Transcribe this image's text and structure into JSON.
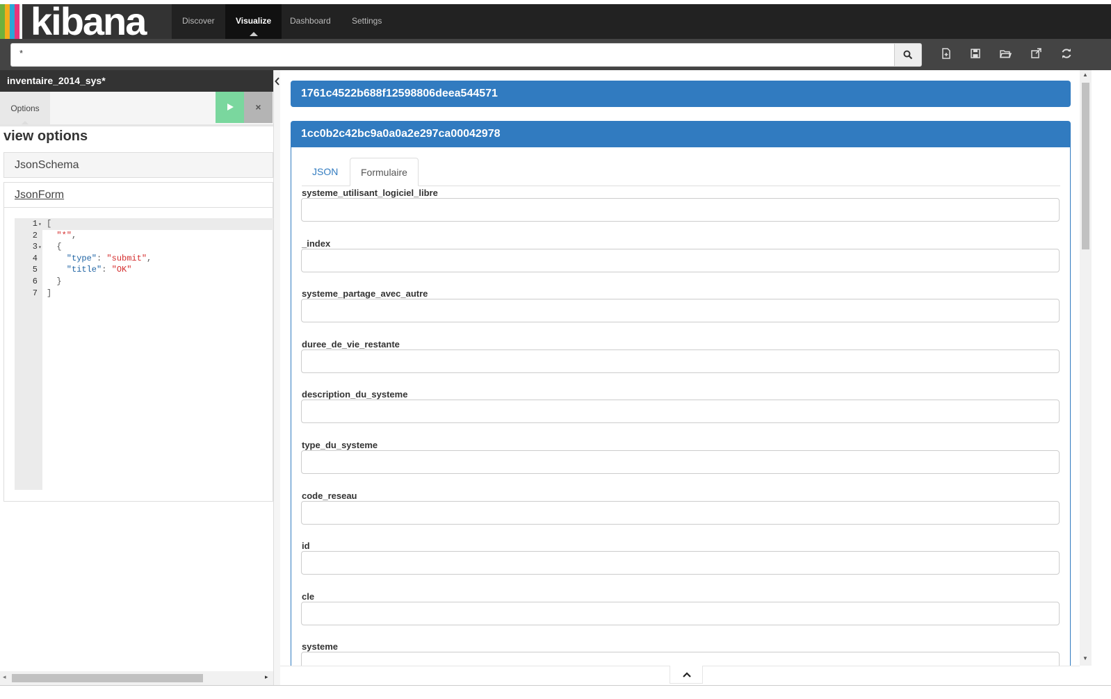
{
  "app": {
    "logo_text": "kibana"
  },
  "nav": {
    "items": [
      "Discover",
      "Visualize",
      "Dashboard",
      "Settings"
    ],
    "active": "Visualize"
  },
  "search": {
    "query": "*"
  },
  "toolbar": {
    "icons": [
      "new-document-icon",
      "save-icon",
      "open-folder-icon",
      "share-icon",
      "refresh-icon"
    ]
  },
  "sidebar": {
    "title": "inventaire_2014_sys*",
    "tab_label": "Options",
    "apply_icon": "play-icon",
    "discard_label": "×",
    "section_title": "view options",
    "panels": {
      "schema": "JsonSchema",
      "form": "JsonForm"
    },
    "code_lines": [
      {
        "num": "1",
        "fold": "▾",
        "parts": [
          [
            "p",
            "["
          ]
        ]
      },
      {
        "num": "2",
        "fold": "",
        "parts": [
          [
            "s",
            "  \"*\""
          ],
          [
            "p",
            ","
          ]
        ]
      },
      {
        "num": "3",
        "fold": "▾",
        "parts": [
          [
            "p",
            "  {"
          ]
        ]
      },
      {
        "num": "4",
        "fold": "",
        "parts": [
          [
            "k",
            "    \"type\""
          ],
          [
            "p",
            ": "
          ],
          [
            "s",
            "\"submit\""
          ],
          [
            "p",
            ","
          ]
        ]
      },
      {
        "num": "5",
        "fold": "",
        "parts": [
          [
            "k",
            "    \"title\""
          ],
          [
            "p",
            ": "
          ],
          [
            "s",
            "\"OK\""
          ]
        ]
      },
      {
        "num": "6",
        "fold": "",
        "parts": [
          [
            "p",
            "  }"
          ]
        ]
      },
      {
        "num": "7",
        "fold": "",
        "parts": [
          [
            "p",
            "]"
          ]
        ]
      }
    ]
  },
  "main": {
    "doc1_id": "1761c4522b688f12598806deea544571",
    "doc2_id": "1cc0b2c42bc9a0a0a2e297ca00042978",
    "tabs": [
      "JSON",
      "Formulaire"
    ],
    "active_tab": "Formulaire",
    "fields": [
      {
        "label": "systeme_utilisant_logiciel_libre",
        "value": ""
      },
      {
        "label": "_index",
        "value": ""
      },
      {
        "label": "systeme_partage_avec_autre",
        "value": ""
      },
      {
        "label": "duree_de_vie_restante",
        "value": ""
      },
      {
        "label": "description_du_systeme",
        "value": ""
      },
      {
        "label": "type_du_systeme",
        "value": ""
      },
      {
        "label": "code_reseau",
        "value": ""
      },
      {
        "label": "id",
        "value": ""
      },
      {
        "label": "cle",
        "value": ""
      },
      {
        "label": "systeme",
        "value": ""
      }
    ]
  },
  "colors": {
    "primary": "#317bc0",
    "navbar": "#222222",
    "apply": "#7ad79e"
  }
}
